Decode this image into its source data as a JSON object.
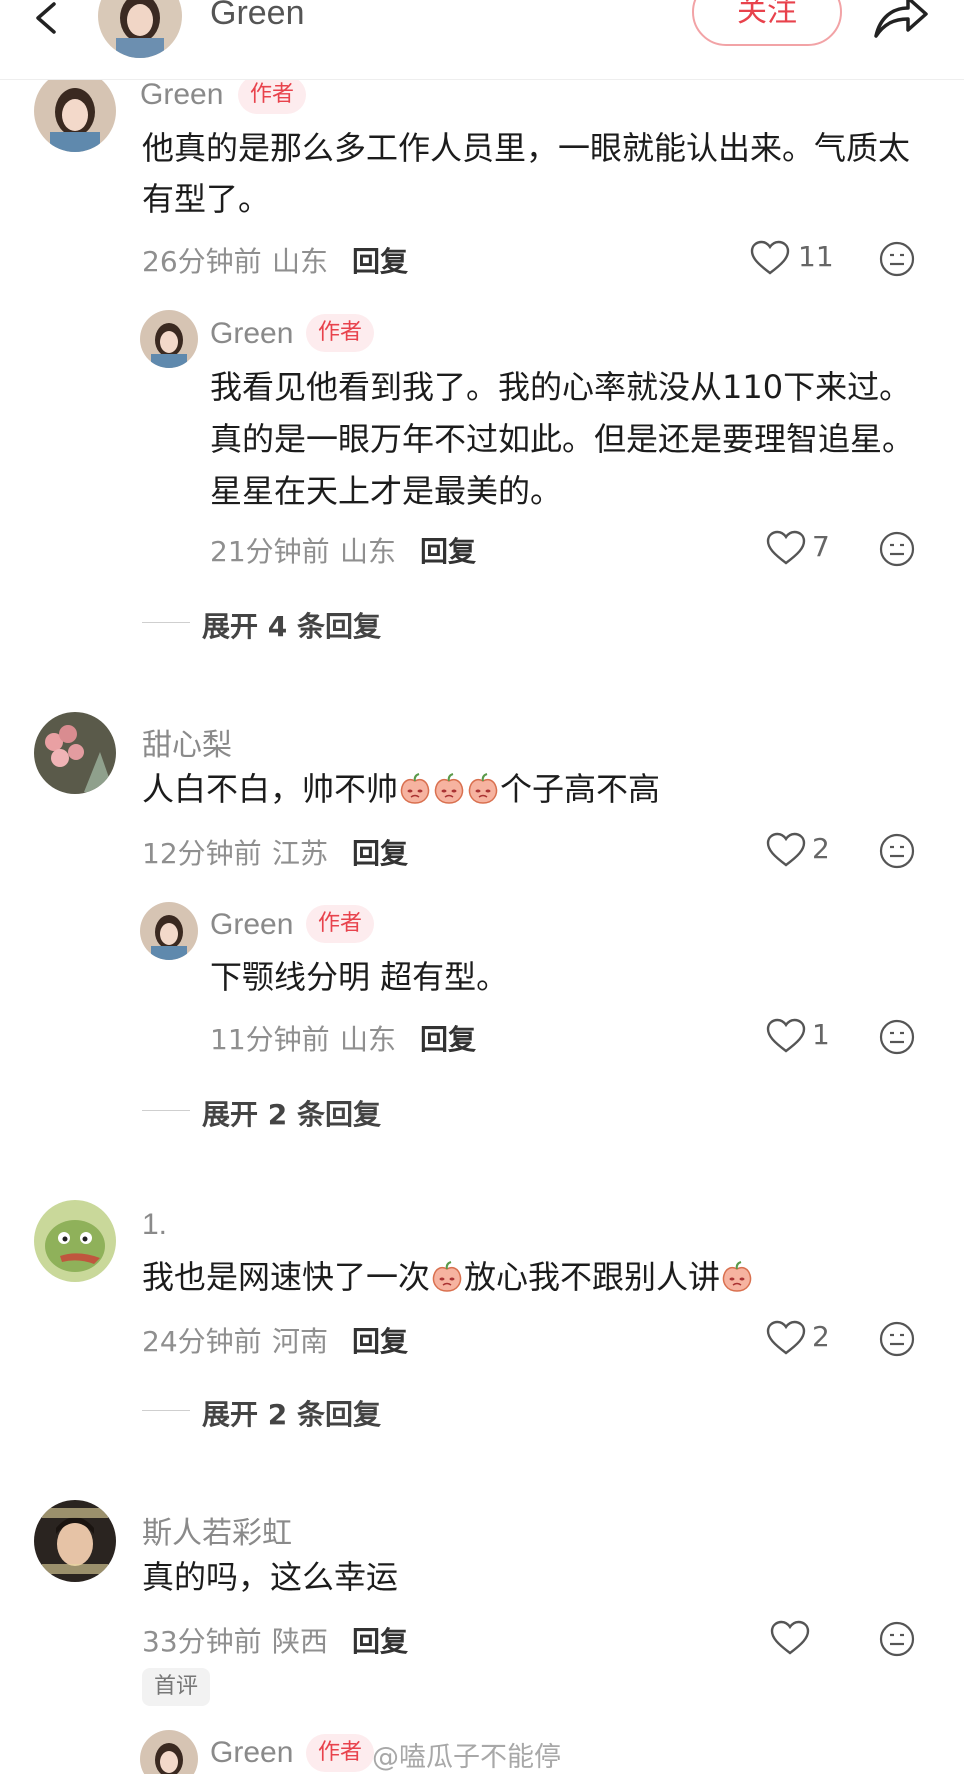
{
  "header": {
    "username": "Green",
    "follow_label": "关注"
  },
  "threads": [
    {
      "name": "Green",
      "author_tag": "作者",
      "text_lines": [
        "他真的是那么多工作人员里，一眼就能认出来。气质太",
        "有型了。"
      ],
      "time": "26分钟前",
      "location": "山东",
      "reply_label": "回复",
      "likes": "11",
      "reply": {
        "name": "Green",
        "author_tag": "作者",
        "text_lines": [
          "我看见他看到我了。我的心率就没从110下来过。",
          "真的是一眼万年不过如此。但是还是要理智追星。",
          "星星在天上才是最美的。"
        ],
        "time": "21分钟前",
        "location": "山东",
        "reply_label": "回复",
        "likes": "7"
      },
      "expand_label": "展开 4 条回复"
    },
    {
      "name": "甜心梨",
      "text_parts": [
        "人白不白，帅不帅",
        "个子高不高"
      ],
      "time": "12分钟前",
      "location": "江苏",
      "reply_label": "回复",
      "likes": "2",
      "reply": {
        "name": "Green",
        "author_tag": "作者",
        "text_lines": [
          "下颚线分明  超有型。"
        ],
        "time": "11分钟前",
        "location": "山东",
        "reply_label": "回复",
        "likes": "1"
      },
      "expand_label": "展开 2 条回复"
    },
    {
      "name": "1.",
      "text_parts": [
        "我也是网速快了一次",
        "放心我不跟别人讲"
      ],
      "time": "24分钟前",
      "location": "河南",
      "reply_label": "回复",
      "likes": "2",
      "expand_label": "展开 2 条回复"
    },
    {
      "name": "斯人若彩虹",
      "text_lines": [
        "真的吗，这么幸运"
      ],
      "time": "33分钟前",
      "location": "陕西",
      "reply_label": "回复",
      "likes": "",
      "first_badge": "首评",
      "reply": {
        "name": "Green",
        "author_tag": "作者"
      }
    }
  ],
  "watermark": "@嗑瓜子不能停",
  "icons": {
    "back": "chevron-left-icon",
    "share": "share-arrow-icon",
    "like": "heart-outline-icon",
    "emoji": "neutral-face-icon",
    "inline_emoji": "peach-emoji"
  },
  "colors": {
    "accent": "#e8424c",
    "author_tag_bg": "#fdecee",
    "meta_text": "#8f8f8f"
  }
}
